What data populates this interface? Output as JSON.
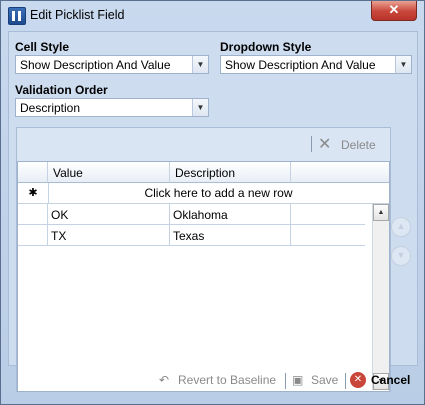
{
  "window": {
    "title": "Edit Picklist Field",
    "close_glyph": "✕"
  },
  "fields": {
    "cell_style": {
      "label": "Cell Style",
      "value": "Show Description And Value"
    },
    "dropdown_style": {
      "label": "Dropdown Style",
      "value": "Show Description And Value"
    },
    "validation_order": {
      "label": "Validation Order",
      "value": "Description"
    }
  },
  "toolbar": {
    "delete_label": "Delete",
    "delete_icon": "close-x-icon"
  },
  "grid": {
    "columns": [
      "Value",
      "Description"
    ],
    "new_row_marker": "✱",
    "new_row_text": "Click here to add a new row",
    "rows": [
      {
        "value": "OK",
        "description": "Oklahoma"
      },
      {
        "value": "TX",
        "description": "Texas"
      }
    ]
  },
  "footer": {
    "revert_label": "Revert to Baseline",
    "save_label": "Save",
    "cancel_label": "Cancel"
  }
}
